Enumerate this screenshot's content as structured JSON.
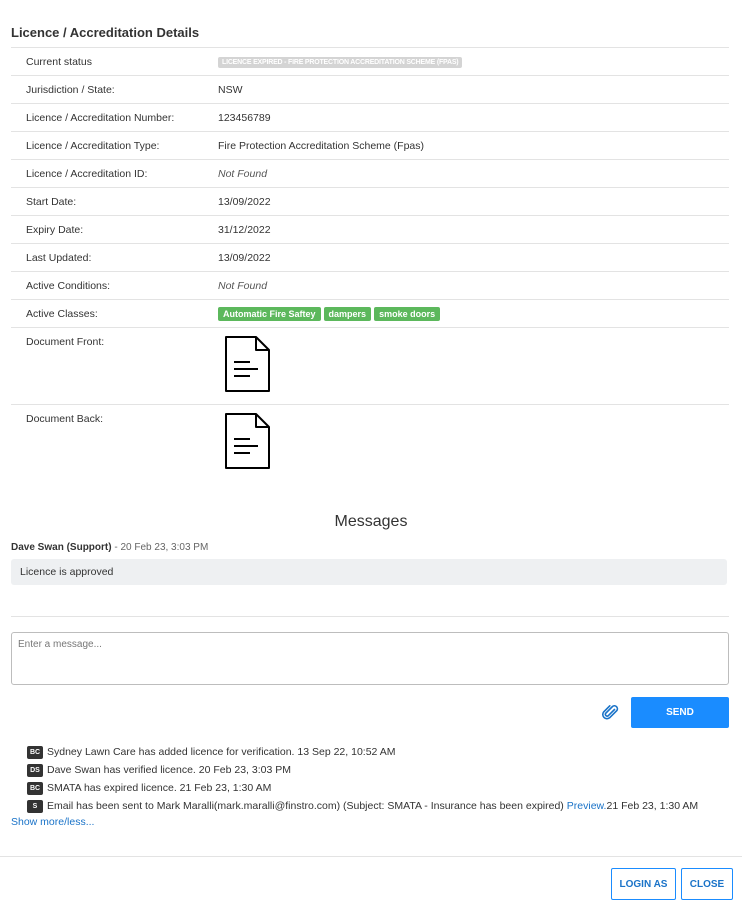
{
  "section_title": "Licence / Accreditation Details",
  "details": [
    {
      "label": "Current status",
      "value": "LICENCE EXPIRED - FIRE PROTECTION ACCREDITATION SCHEME (FPAS)"
    },
    {
      "label": "Jurisdiction / State:",
      "value": "NSW"
    },
    {
      "label": "Licence / Accreditation Number:",
      "value": "123456789"
    },
    {
      "label": "Licence / Accreditation Type:",
      "value": "Fire Protection Accreditation Scheme (Fpas)"
    },
    {
      "label": "Licence / Accreditation ID:",
      "value": "Not Found"
    },
    {
      "label": "Start Date:",
      "value": "13/09/2022"
    },
    {
      "label": "Expiry Date:",
      "value": "31/12/2022"
    },
    {
      "label": "Last Updated:",
      "value": "13/09/2022"
    },
    {
      "label": "Active Conditions:",
      "value": "Not Found"
    },
    {
      "label": "Active Classes:",
      "classes": [
        "Automatic Fire Saftey",
        "dampers",
        "smoke doors"
      ]
    },
    {
      "label": "Document Front:"
    },
    {
      "label": "Document Back:"
    }
  ],
  "messages": {
    "title": "Messages",
    "author": "Dave Swan (Support)",
    "time": " - 20 Feb 23, 3:03 PM",
    "text": "Licence is approved",
    "input_placeholder": "Enter a message...",
    "send_label": "SEND"
  },
  "log": [
    {
      "initials": "BC",
      "text": "Sydney Lawn Care has added licence for verification. 13 Sep 22, 10:52 AM"
    },
    {
      "initials": "DS",
      "text": "Dave Swan has verified licence. 20 Feb 23, 3:03 PM"
    },
    {
      "initials": "BC",
      "text": "SMATA has expired licence. 21 Feb 23, 1:30 AM"
    },
    {
      "initials": "S",
      "text": "Email has been sent to Mark Maralli(mark.maralli@finstro.com) (Subject: SMATA - Insurance has been expired)",
      "link": "Preview.",
      "after": " 21 Feb 23, 1:30 AM"
    }
  ],
  "show_more": "Show more/less...",
  "footer": {
    "login_label": "LOGIN AS",
    "close_label": "CLOSE"
  }
}
